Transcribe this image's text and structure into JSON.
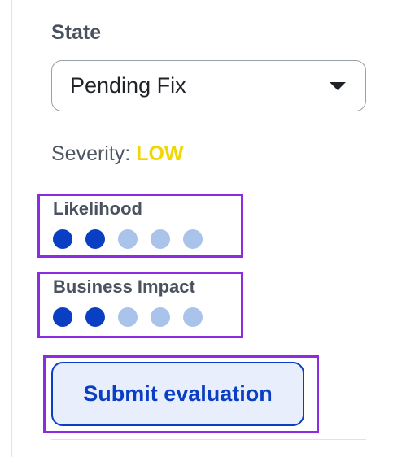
{
  "state": {
    "label": "State",
    "selected": "Pending Fix"
  },
  "severity": {
    "label": "Severity:",
    "value": "LOW",
    "color": "#f2d600"
  },
  "likelihood": {
    "label": "Likelihood",
    "rating": 2,
    "max": 5
  },
  "business_impact": {
    "label": "Business Impact",
    "rating": 2,
    "max": 5
  },
  "submit": {
    "label": "Submit evaluation"
  },
  "colors": {
    "accent": "#0a3fc4",
    "dot_inactive": "#a9c3ea",
    "highlight_border": "#8b2be2"
  }
}
